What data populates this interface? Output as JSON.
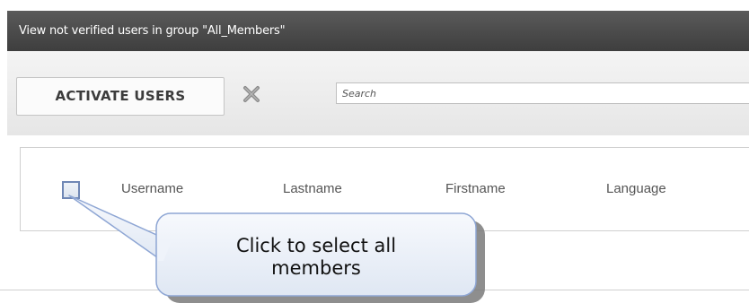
{
  "dialog": {
    "title": "View not verified users in group \"All_Members\""
  },
  "toolbar": {
    "activate_label": "ACTIVATE USERS",
    "clear_icon": "x-icon",
    "search_placeholder": "Search"
  },
  "table": {
    "columns": [
      "Username",
      "Lastname",
      "Firstname",
      "Language"
    ]
  },
  "callout": {
    "text_line1": "Click to select all",
    "text_line2": "members"
  }
}
